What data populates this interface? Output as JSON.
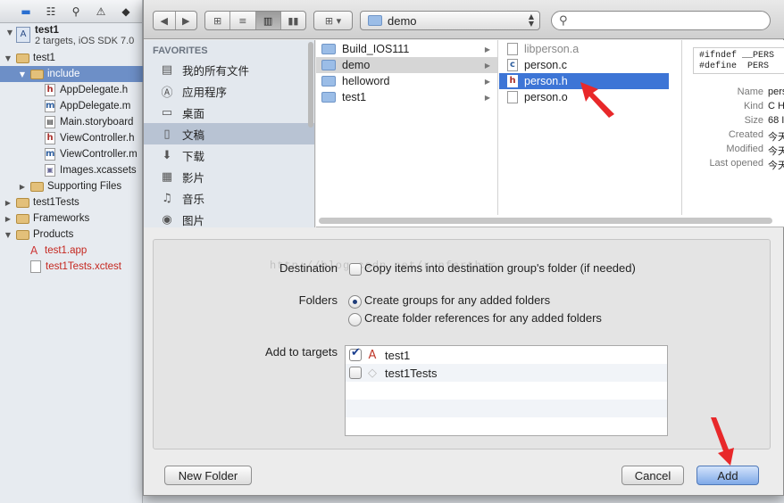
{
  "navigator": {
    "toolbar_icons": [
      "folder-icon",
      "hierarchy-icon",
      "search-icon",
      "warning-icon",
      "diamond-icon"
    ],
    "project": {
      "name": "test1",
      "subtitle": "2 targets, iOS SDK 7.0"
    },
    "items": [
      {
        "label": "test1",
        "indent": 1,
        "type": "folder",
        "open": true
      },
      {
        "label": "include",
        "indent": 2,
        "type": "folder",
        "open": true,
        "selected": true
      },
      {
        "label": "AppDelegate.h",
        "indent": 3,
        "type": "h"
      },
      {
        "label": "AppDelegate.m",
        "indent": 3,
        "type": "m"
      },
      {
        "label": "Main.storyboard",
        "indent": 3,
        "type": "sb"
      },
      {
        "label": "ViewController.h",
        "indent": 3,
        "type": "h"
      },
      {
        "label": "ViewController.m",
        "indent": 3,
        "type": "m"
      },
      {
        "label": "Images.xcassets",
        "indent": 3,
        "type": "xc"
      },
      {
        "label": "Supporting Files",
        "indent": 2,
        "type": "folder",
        "open": false
      },
      {
        "label": "test1Tests",
        "indent": 1,
        "type": "folder",
        "open": false
      },
      {
        "label": "Frameworks",
        "indent": 1,
        "type": "folder",
        "open": false
      },
      {
        "label": "Products",
        "indent": 1,
        "type": "folder",
        "open": true
      },
      {
        "label": "test1.app",
        "indent": 2,
        "type": "app",
        "missing": true
      },
      {
        "label": "test1Tests.xctest",
        "indent": 2,
        "type": "file",
        "missing": true
      }
    ]
  },
  "dialog": {
    "nav_back": "◀",
    "nav_forward": "▶",
    "location": "demo",
    "search": {
      "value": "",
      "placeholder": ""
    },
    "favorites_header": "FAVORITES",
    "favorites": [
      {
        "label": "我的所有文件",
        "icon": "all-files-icon"
      },
      {
        "label": "应用程序",
        "icon": "applications-icon"
      },
      {
        "label": "桌面",
        "icon": "desktop-icon"
      },
      {
        "label": "文稿",
        "icon": "documents-icon",
        "selected": true
      },
      {
        "label": "下载",
        "icon": "downloads-icon"
      },
      {
        "label": "影片",
        "icon": "movies-icon"
      },
      {
        "label": "音乐",
        "icon": "music-icon"
      },
      {
        "label": "图片",
        "icon": "pictures-icon"
      }
    ],
    "column1": [
      {
        "label": "Build_IOS111"
      },
      {
        "label": "demo",
        "selected": true
      },
      {
        "label": "helloword"
      },
      {
        "label": "test1"
      }
    ],
    "column2": [
      {
        "label": "libperson.a",
        "type": "a",
        "dim": true
      },
      {
        "label": "person.c",
        "type": "c"
      },
      {
        "label": "person.h",
        "type": "h",
        "selected": true
      },
      {
        "label": "person.o",
        "type": "o"
      }
    ],
    "preview": {
      "code_line1": "#ifndef __PERS",
      "code_line2": "#define  PERS",
      "info": [
        {
          "key": "Name",
          "value": "pers"
        },
        {
          "key": "Kind",
          "value": "C H"
        },
        {
          "key": "Size",
          "value": "68 I"
        },
        {
          "key": "Created",
          "value": "今天"
        },
        {
          "key": "Modified",
          "value": "今天"
        },
        {
          "key": "Last opened",
          "value": "今天"
        }
      ]
    },
    "options": {
      "watermark": "http://blog.csdn.net/runfarther",
      "destination_label": "Destination",
      "destination_text": "Copy items into destination group's folder (if needed)",
      "destination_checked": false,
      "folders_label": "Folders",
      "folders_option1": "Create groups for any added folders",
      "folders_option2": "Create folder references for any added folders",
      "folders_selected": 1,
      "targets_label": "Add to targets",
      "targets": [
        {
          "label": "test1",
          "checked": true
        },
        {
          "label": "test1Tests",
          "checked": false
        }
      ]
    },
    "buttons": {
      "new_folder": "New Folder",
      "cancel": "Cancel",
      "add": "Add"
    }
  },
  "colors": {
    "selection_blue": "#3d75d6",
    "arrow_red": "#e8282a",
    "sidebar_selected": "#b8c3d3"
  }
}
